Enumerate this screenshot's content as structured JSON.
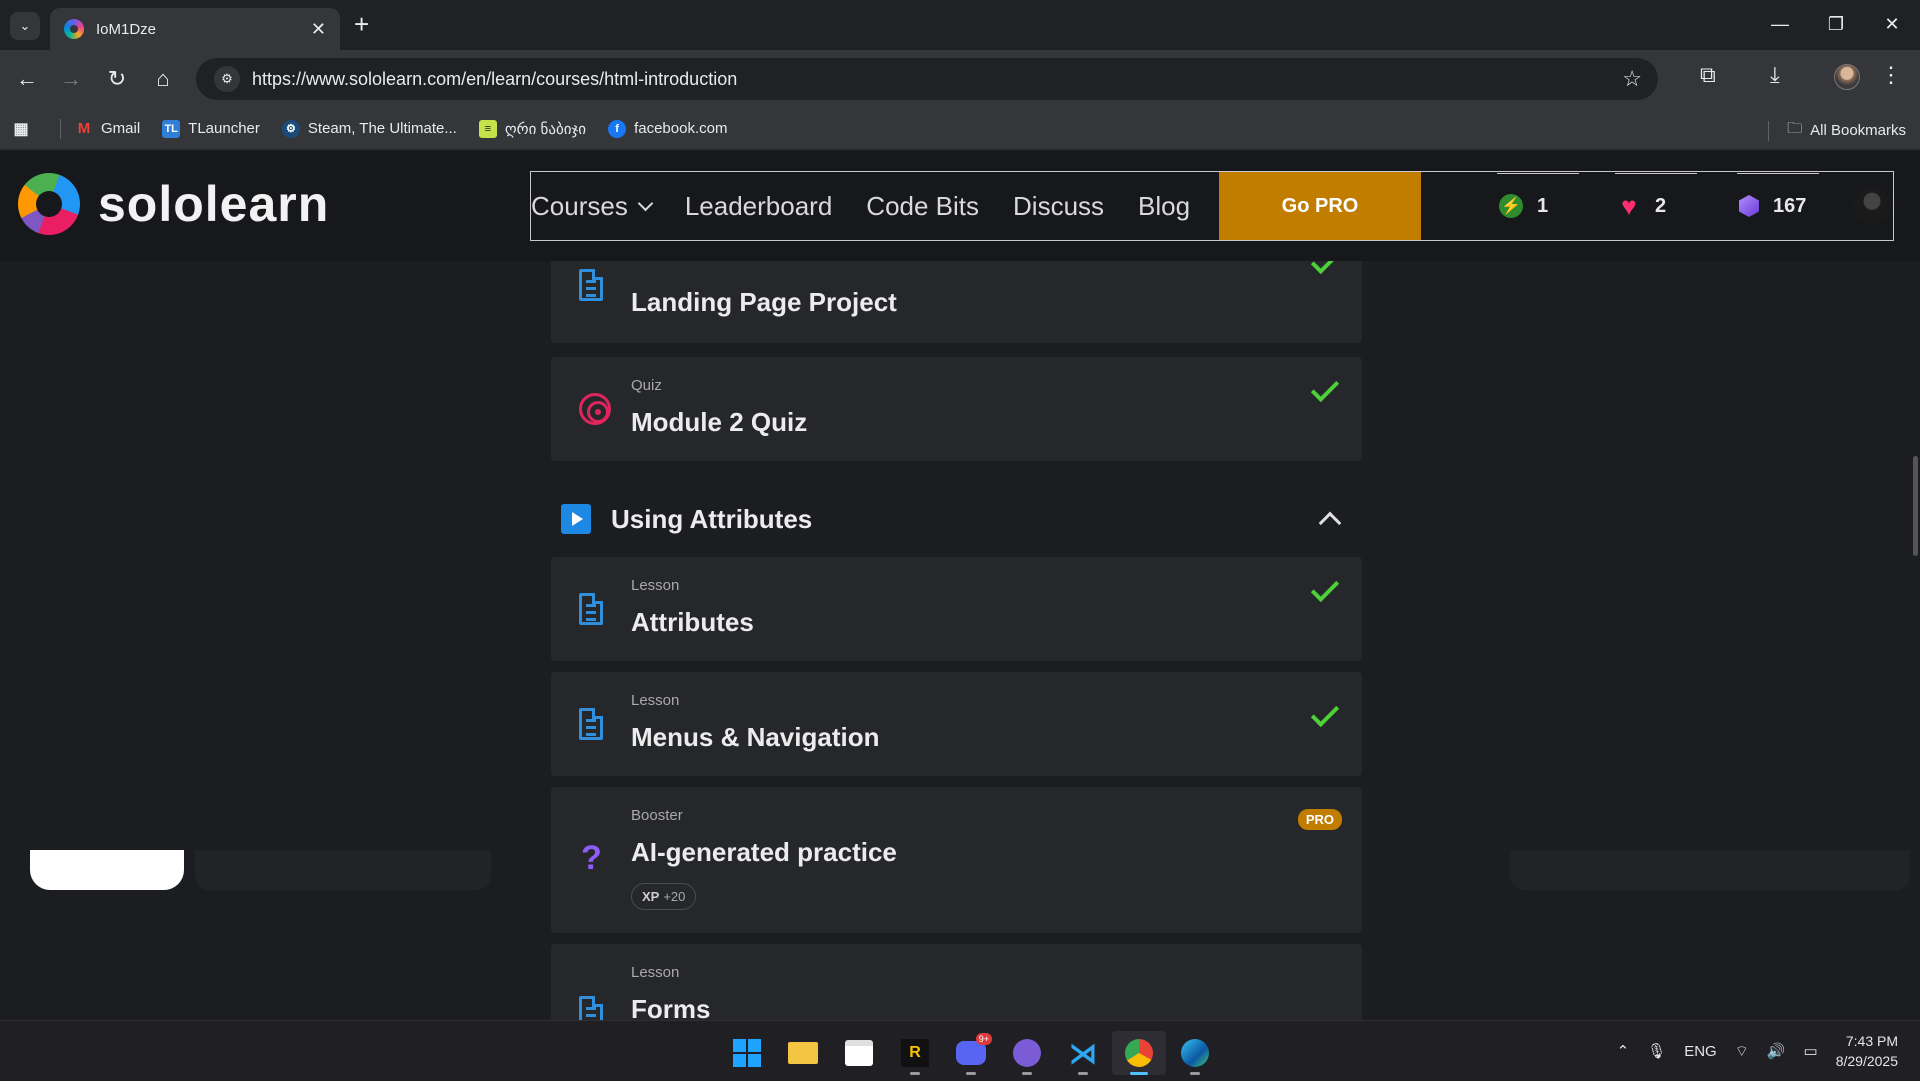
{
  "browser": {
    "tab_title": "IoM1Dze",
    "url": "https://www.sololearn.com/en/learn/courses/html-introduction",
    "bookmarks": [
      {
        "label": "Gmail",
        "icon": "gmail-icon"
      },
      {
        "label": "TLauncher",
        "icon": "tlauncher-icon"
      },
      {
        "label": "Steam, The Ultimate...",
        "icon": "steam-icon"
      },
      {
        "label": "ღრი ნაბიჯი",
        "icon": "bookmark-page-icon"
      },
      {
        "label": "facebook.com",
        "icon": "facebook-icon"
      }
    ],
    "all_bookmarks": "All Bookmarks"
  },
  "site": {
    "logo_text": "sololearn",
    "nav": {
      "courses": "Courses",
      "leaderboard": "Leaderboard",
      "code_bits": "Code Bits",
      "discuss": "Discuss",
      "blog": "Blog",
      "go_pro": "Go PRO"
    },
    "stats": {
      "streak": "1",
      "hearts": "2",
      "bits": "167"
    }
  },
  "course": {
    "items": [
      {
        "kind": "",
        "title": "Landing Page Project",
        "icon": "lesson-doc-icon",
        "completed": true
      },
      {
        "kind": "Quiz",
        "title": "Module 2 Quiz",
        "icon": "target-icon",
        "completed": true
      }
    ],
    "module": {
      "title": "Using Attributes",
      "expanded": true
    },
    "module_items": [
      {
        "kind": "Lesson",
        "title": "Attributes",
        "icon": "lesson-doc-icon",
        "completed": true
      },
      {
        "kind": "Lesson",
        "title": "Menus & Navigation",
        "icon": "lesson-doc-icon",
        "completed": true
      },
      {
        "kind": "Booster",
        "title": "AI-generated practice",
        "icon": "question-icon",
        "badge": "PRO",
        "xp_label": "XP",
        "xp_value": "+20"
      },
      {
        "kind": "Lesson",
        "title": "Forms",
        "icon": "lesson-doc-icon"
      }
    ]
  },
  "taskbar": {
    "language": "ENG",
    "time": "7:43 PM",
    "date": "8/29/2025",
    "discord_badge": "9+"
  },
  "colors": {
    "accent_pro": "#c17d00",
    "check_green": "#4cd137",
    "lesson_blue": "#2f8fdd",
    "quiz_red": "#e0245e",
    "booster_purple": "#8e5cf7"
  }
}
